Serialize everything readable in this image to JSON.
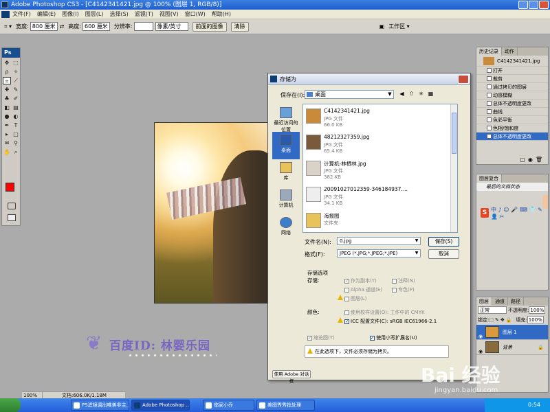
{
  "window": {
    "title": "Adobe Photoshop CS3 - [C4142341421.jpg @ 100% (图层 1, RGB/8)]"
  },
  "menu": [
    "文件(F)",
    "编辑(E)",
    "图像(I)",
    "图层(L)",
    "选择(S)",
    "滤镜(T)",
    "视图(V)",
    "窗口(W)",
    "帮助(H)"
  ],
  "options": {
    "width_label": "宽度:",
    "width_value": "800 厘米",
    "height_label": "高度:",
    "height_value": "600 厘米",
    "res_label": "分辨率:",
    "res_unit": "像素/英寸",
    "front_image": "前面的图像",
    "clear": "清除",
    "workspace": "工作区 ▾"
  },
  "toolbox": {
    "title": "Ps"
  },
  "statusbar": {
    "zoom": "100%",
    "doc": "文档:606.0K/1.18M"
  },
  "watermark": {
    "text": "百度ID: 林婴乐园"
  },
  "dialog": {
    "title": "存储为",
    "save_in_label": "保存在(I):",
    "save_in_value": "桌面",
    "places": [
      {
        "label": "最近访问的位置",
        "active": false
      },
      {
        "label": "桌面",
        "active": true
      },
      {
        "label": "库",
        "active": false
      },
      {
        "label": "计算机",
        "active": false
      },
      {
        "label": "网络",
        "active": false
      }
    ],
    "files": [
      {
        "name": "C4142341421.jpg",
        "type": "JPG 文件",
        "size": "66.0 KB",
        "thumb": "#c98b3a"
      },
      {
        "name": "48212327359.jpg",
        "type": "JPG 文件",
        "size": "65.4 KB",
        "thumb": "#7a5a3a"
      },
      {
        "name": "计算机-林栖林.jpg",
        "type": "JPG 文件",
        "size": "382 KB",
        "thumb": "#d9d2c8"
      },
      {
        "name": "20091027012359-346184937....",
        "type": "JPG 文件",
        "size": "34.1 KB",
        "thumb": "#eeeeee"
      },
      {
        "name": "海报图",
        "type": "文件夹",
        "size": "",
        "thumb": "#e8c25a"
      }
    ],
    "filename_label": "文件名(N):",
    "filename_value": "0.jpg",
    "format_label": "格式(F):",
    "format_value": "JPEG (*.JPG;*.JPEG;*.JPE)",
    "save_button": "保存(S)",
    "cancel_button": "取消",
    "save_options_title": "存储选项",
    "save_sub": "存储:",
    "opt_copy": "作为副本(Y)",
    "opt_notes": "注释(N)",
    "opt_alpha": "Alpha 通道(E)",
    "opt_spot": "专色(P)",
    "opt_layers": "图层(L)",
    "color_label": "颜色:",
    "opt_proof": "使用校样设置(O): 工作中的 CMYK",
    "opt_icc": "ICC 配置文件(C): sRGB IEC61966-2.1",
    "opt_thumb": "缩览图(T)",
    "opt_lower_ext": "使用小写扩展名(U)",
    "warning": "在此选项下，文件必须存储为拷贝。",
    "use_adobe_dialog": "使用 Adobe 对话框"
  },
  "history": {
    "tabs": [
      "历史记录",
      "动作"
    ],
    "snapshot": "C4142341421.jpg",
    "items": [
      {
        "label": "打开",
        "selected": false
      },
      {
        "label": "裁剪",
        "selected": false
      },
      {
        "label": "通过拷贝的图层",
        "selected": false
      },
      {
        "label": "动感模糊",
        "selected": false
      },
      {
        "label": "总体不透明度更改",
        "selected": false
      },
      {
        "label": "曲线",
        "selected": false
      },
      {
        "label": "色彩平衡",
        "selected": false
      },
      {
        "label": "色相/饱和度",
        "selected": false
      },
      {
        "label": "总体不透明度更改",
        "selected": true
      }
    ]
  },
  "navpanel": {
    "tabs": [
      "图层复合"
    ],
    "last_state": "最后的文档状态",
    "sogou": "中 ♪ ☺ 🎤 ⌨ 👕 ✎ 👤 ✂"
  },
  "layers": {
    "tabs": [
      "图层",
      "通道",
      "路径"
    ],
    "blend_mode": "正常",
    "opacity_label": "不透明度:",
    "opacity_value": "100%",
    "lock_label": "锁定:",
    "fill_label": "填充:",
    "fill_value": "100%",
    "items": [
      {
        "name": "图层 1",
        "selected": true,
        "thumb": "#d99a3e"
      },
      {
        "name": "背景",
        "selected": false,
        "thumb": "#8a6a3a"
      }
    ]
  },
  "taskbar": {
    "items": [
      {
        "label": "PS滤镜调出唯美非主...",
        "active": false
      },
      {
        "label": "Adobe Photoshop ...",
        "active": true
      },
      {
        "label": "临家小乔",
        "active": false
      },
      {
        "label": "美图秀秀批处理",
        "active": false
      }
    ],
    "time": "0:54"
  },
  "baidu": {
    "logo": "Bai 经验",
    "url": "jingyan.baidu.com"
  },
  "colors": {
    "accent": "#316ac5",
    "titlebar": "#245edb",
    "fg_swatch": "#ff0000"
  }
}
